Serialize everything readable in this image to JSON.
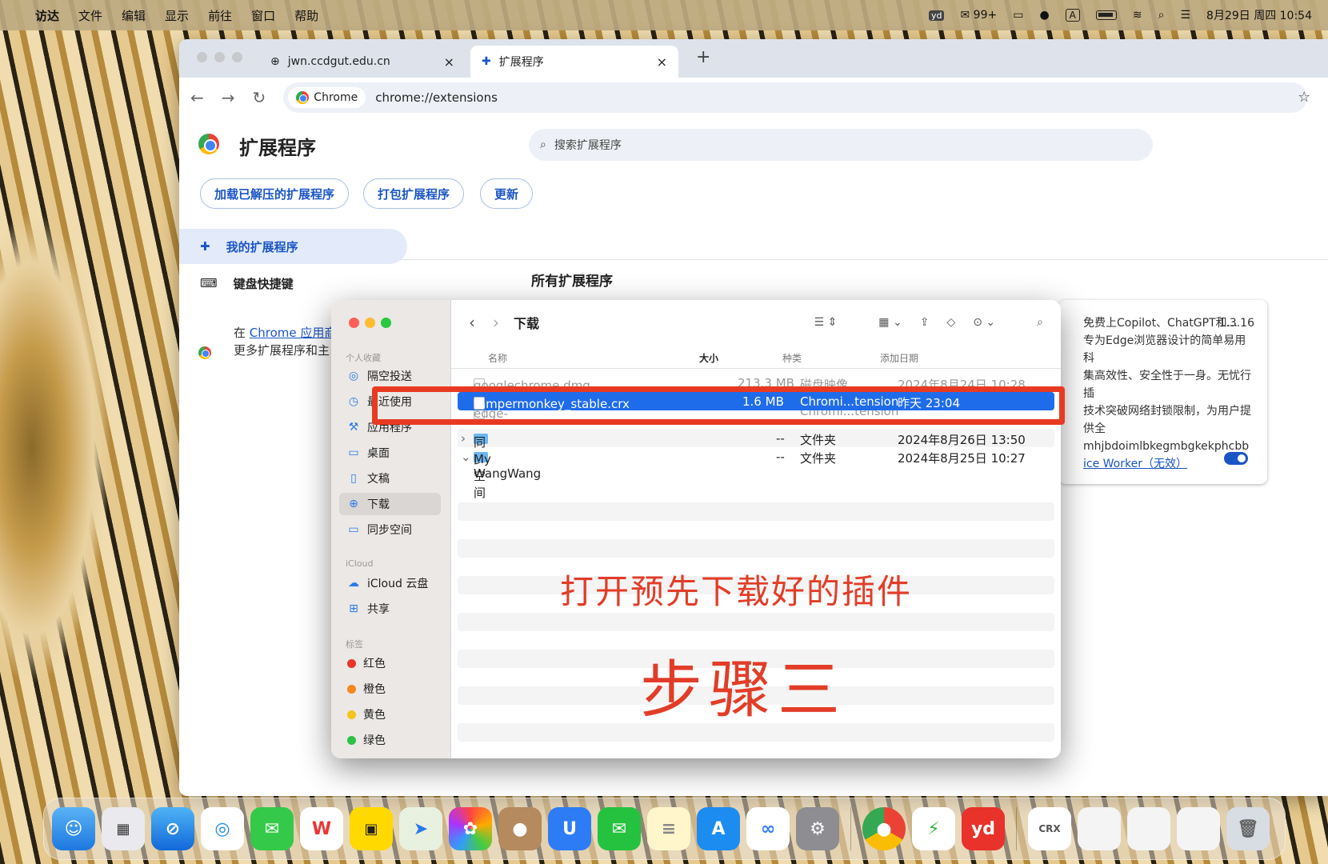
{
  "menubar": {
    "items": [
      "访达",
      "文件",
      "编辑",
      "显示",
      "前往",
      "窗口",
      "帮助"
    ],
    "status": {
      "wechat_count": "99+",
      "input": "A",
      "datetime": "8月29日 周四 10:54"
    }
  },
  "browser": {
    "tabs": [
      {
        "title": "jwn.ccdgut.edu.cn"
      },
      {
        "title": "扩展程序"
      }
    ],
    "new_tab": "+",
    "chip": "Chrome",
    "url": "chrome://extensions",
    "page": {
      "title": "扩展程序",
      "search_placeholder": "搜索扩展程序",
      "buttons": [
        "加载已解压的扩展程序",
        "打包扩展程序",
        "更新"
      ],
      "nav": [
        "我的扩展程序",
        "键盘快捷键"
      ],
      "section": "所有扩展程序",
      "store_prefix": "在",
      "store_link": "Chrome 应用商",
      "store_line2": "更多扩展程序和主",
      "card": {
        "title": "免费上Copilot、ChatGPT和...",
        "version": "1.3.16",
        "desc1": "专为Edge浏览器设计的简单易用科",
        "desc2": "集高效性、安全性于一身。无忧行插",
        "desc3": "技术突破网络封锁限制，为用户提供全",
        "id": "mhjbdoimlbkegmbgkekphcbb",
        "worker": "ice Worker（无效）"
      }
    }
  },
  "finder": {
    "title": "下载",
    "sidebar": {
      "favorites_header": "个人收藏",
      "favorites": [
        "隔空投送",
        "最近使用",
        "应用程序",
        "桌面",
        "文稿",
        "下载",
        "同步空间"
      ],
      "icloud_header": "iCloud",
      "icloud": [
        "iCloud 云盘",
        "共享"
      ],
      "tags_header": "标签",
      "tags": [
        {
          "name": "红色",
          "color": "#e8342a"
        },
        {
          "name": "橙色",
          "color": "#f5871f"
        },
        {
          "name": "黄色",
          "color": "#f4c31c"
        },
        {
          "name": "绿色",
          "color": "#2cc245"
        }
      ]
    },
    "columns": [
      "名称",
      "大小",
      "种类",
      "添加日期"
    ],
    "rows": [
      {
        "name": "googlechrome.dmg",
        "size": "213.3 MB",
        "kind": "磁盘映像",
        "date": "2024年8月24日 10:28"
      },
      {
        "name": "tampermonkey_stable.crx",
        "size": "1.6 MB",
        "kind": "Chromi...tension",
        "date": "昨天 23:04"
      },
      {
        "name": "edge-extension",
        "size": "",
        "kind": "Chromi...tension",
        "date": ""
      },
      {
        "name": "同步空间",
        "size": "--",
        "kind": "文件夹",
        "date": "2024年8月26日 13:50"
      },
      {
        "name": "My WangWang",
        "size": "--",
        "kind": "文件夹",
        "date": "2024年8月25日 10:27"
      }
    ]
  },
  "annotation": {
    "caption": "打开预先下载好的插件",
    "step": "步骤三"
  },
  "colors": {
    "accent": "#1a55c5",
    "annotation": "#e23d28",
    "selection": "#1f6cea"
  }
}
